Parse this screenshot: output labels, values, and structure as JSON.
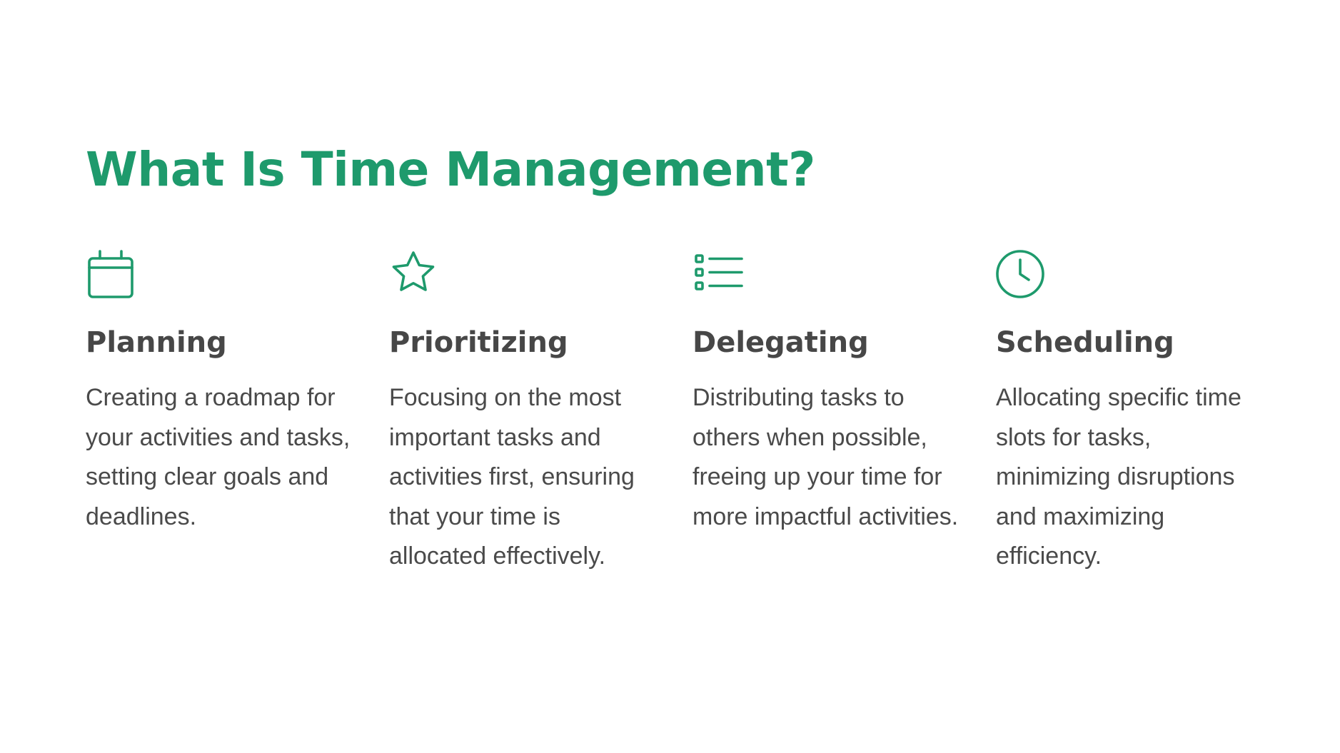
{
  "title": "What Is Time Management?",
  "accent_color": "#1e9a6c",
  "text_color": "#4a4a4a",
  "items": [
    {
      "icon": "calendar-icon",
      "title": "Planning",
      "text": "Creating a roadmap for your activities and tasks, setting clear goals and deadlines."
    },
    {
      "icon": "star-icon",
      "title": "Prioritizing",
      "text": "Focusing on the most important tasks and activities first, ensuring that your time is allocated effectively."
    },
    {
      "icon": "list-icon",
      "title": "Delegating",
      "text": "Distributing tasks to others when possible, freeing up your time for more impactful activities."
    },
    {
      "icon": "clock-icon",
      "title": "Scheduling",
      "text": "Allocating specific time slots for tasks, minimizing disruptions and maximizing efficiency."
    }
  ]
}
